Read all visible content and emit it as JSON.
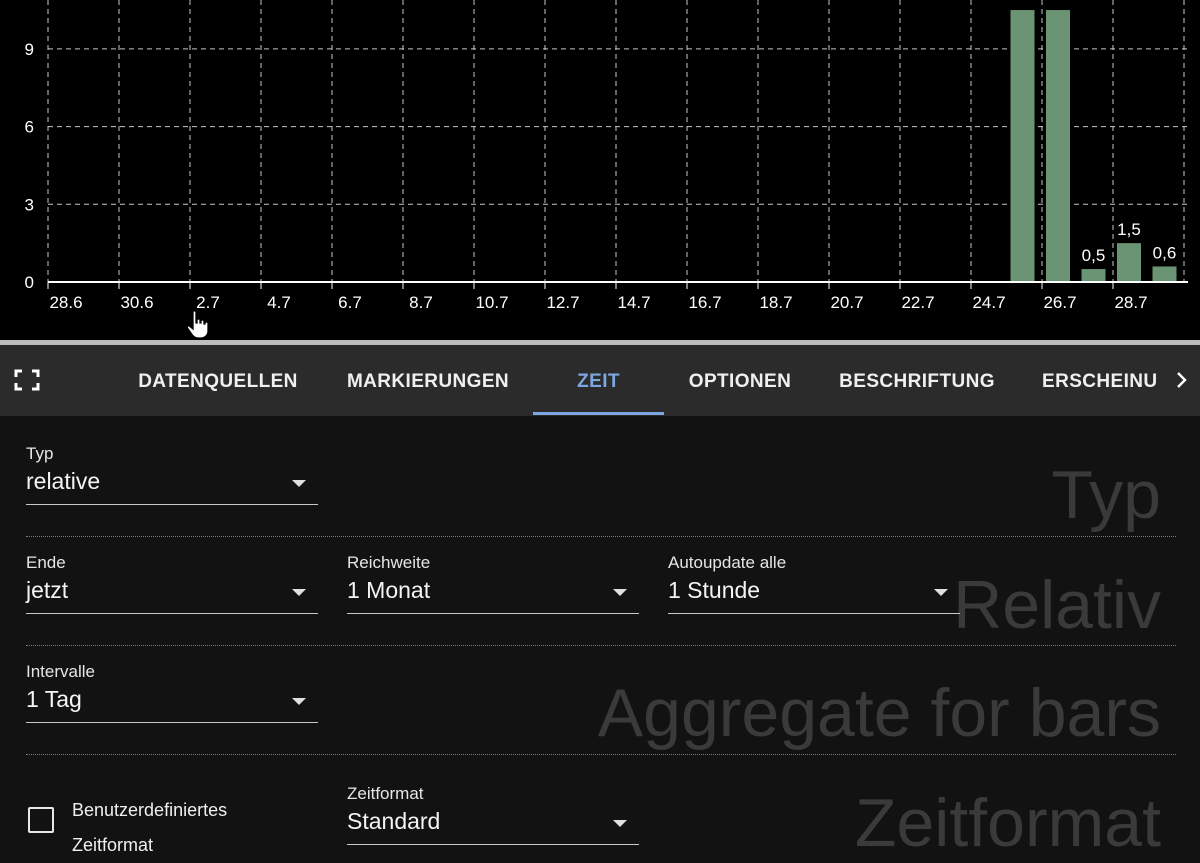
{
  "chart_data": {
    "type": "bar",
    "x_tick_labels": [
      "28.6",
      "30.6",
      "2.7",
      "4.7",
      "6.7",
      "8.7",
      "10.7",
      "12.7",
      "14.7",
      "16.7",
      "18.7",
      "20.7",
      "22.7",
      "24.7",
      "26.7",
      "28.7"
    ],
    "y_tick_labels": [
      "0",
      "3",
      "6",
      "9"
    ],
    "ylim": [
      0,
      10.5
    ],
    "bars": [
      {
        "x": "25.7",
        "value": 10.5,
        "label": ""
      },
      {
        "x": "26.7",
        "value": 10.5,
        "label": ""
      },
      {
        "x": "27.7",
        "value": 0.5,
        "label": "0,5"
      },
      {
        "x": "28.7",
        "value": 1.5,
        "label": "1,5"
      },
      {
        "x": "29.7",
        "value": 0.6,
        "label": "0,6"
      }
    ],
    "grid": true,
    "bar_color": "#6b9474"
  },
  "tabs": [
    {
      "label": "DATENQUELLEN",
      "active": false
    },
    {
      "label": "MARKIERUNGEN",
      "active": false
    },
    {
      "label": "ZEIT",
      "active": true
    },
    {
      "label": "OPTIONEN",
      "active": false
    },
    {
      "label": "BESCHRIFTUNG",
      "active": false
    },
    {
      "label": "ERSCHEINUNG",
      "active": false
    }
  ],
  "icons": {
    "fullscreen": "fullscreen-icon",
    "scroll_right": "chevron-right-icon",
    "cursor": "hand-cursor-icon",
    "dropdown": "arrow-drop-down-icon"
  },
  "sections": {
    "typ": "Typ",
    "relativ": "Relativ",
    "aggregate": "Aggregate for bars",
    "zeitformat": "Zeitformat"
  },
  "fields": {
    "typ": {
      "label": "Typ",
      "value": "relative"
    },
    "ende": {
      "label": "Ende",
      "value": "jetzt"
    },
    "reichweite": {
      "label": "Reichweite",
      "value": "1 Monat"
    },
    "autoupdate": {
      "label": "Autoupdate alle",
      "value": "1 Stunde"
    },
    "intervalle": {
      "label": "Intervalle",
      "value": "1 Tag"
    },
    "zeitformat": {
      "label": "Zeitformat",
      "value": "Standard"
    }
  },
  "custom_format": {
    "checked": false,
    "label_line1": "Benutzerdefiniertes",
    "label_line2": "Zeitformat"
  },
  "colors": {
    "accent": "#7ea6e0",
    "bar": "#6b9474",
    "tabbar_bg": "#2b2b2b",
    "panel_bg": "#121212"
  }
}
